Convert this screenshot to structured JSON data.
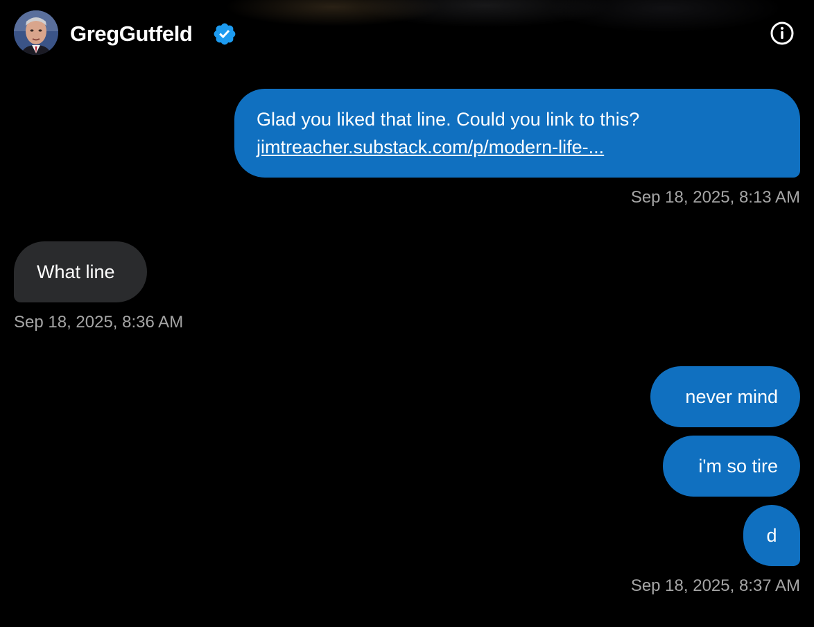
{
  "header": {
    "name": "GregGutfeld",
    "verified": true,
    "avatar_icon": "avatar-photo",
    "info_icon": "info-icon"
  },
  "messages": [
    {
      "direction": "outgoing",
      "text": "Glad you liked that line. Could you link to this?",
      "link": "jimtreacher.substack.com/p/modern-life-...",
      "timestamp": "Sep 18, 2025, 8:13 AM"
    },
    {
      "direction": "incoming",
      "text": "What line",
      "timestamp": "Sep 18, 2025, 8:36 AM"
    },
    {
      "direction": "outgoing",
      "text": "never mind"
    },
    {
      "direction": "outgoing",
      "text": "i'm so tire"
    },
    {
      "direction": "outgoing",
      "text": "d",
      "timestamp": "Sep 18, 2025, 8:37 AM"
    }
  ],
  "colors": {
    "outgoing_bubble": "#1070c0",
    "incoming_bubble": "#2a2b2d",
    "timestamp": "#a5a5a5",
    "verified_badge": "#1d9bf0"
  }
}
